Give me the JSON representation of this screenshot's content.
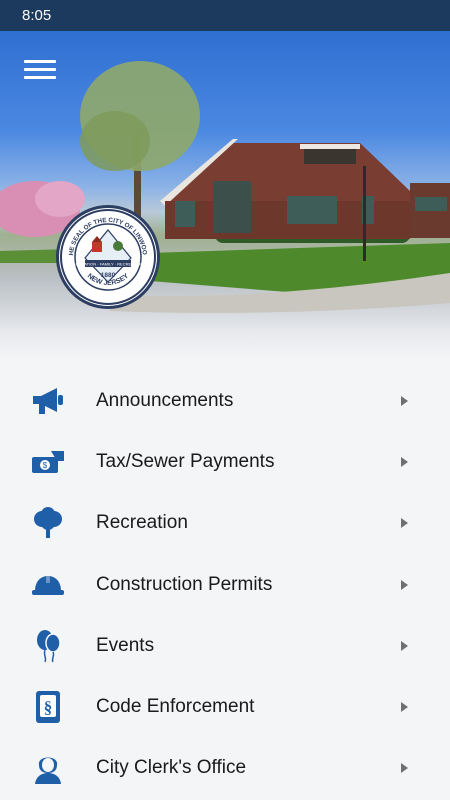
{
  "status_bar": {
    "time": "8:05"
  },
  "header": {
    "menu_icon": "hamburger-icon"
  },
  "seal": {
    "top_text": "THE SEAL OF THE CITY OF LINWOOD",
    "bottom_text": "NEW JERSEY",
    "year": "1880",
    "ribbon": "EDUCATION · FAMILY · RECREATION"
  },
  "menu": {
    "accent_color": "#1f5fa8",
    "items": [
      {
        "label": "Announcements",
        "icon": "megaphone-icon"
      },
      {
        "label": "Tax/Sewer Payments",
        "icon": "payment-hand-icon"
      },
      {
        "label": "Recreation",
        "icon": "tree-icon"
      },
      {
        "label": "Construction Permits",
        "icon": "hard-hat-icon"
      },
      {
        "label": "Events",
        "icon": "balloons-icon"
      },
      {
        "label": "Code Enforcement",
        "icon": "code-book-icon"
      },
      {
        "label": "City Clerk's Office",
        "icon": "clerk-person-icon"
      }
    ]
  }
}
